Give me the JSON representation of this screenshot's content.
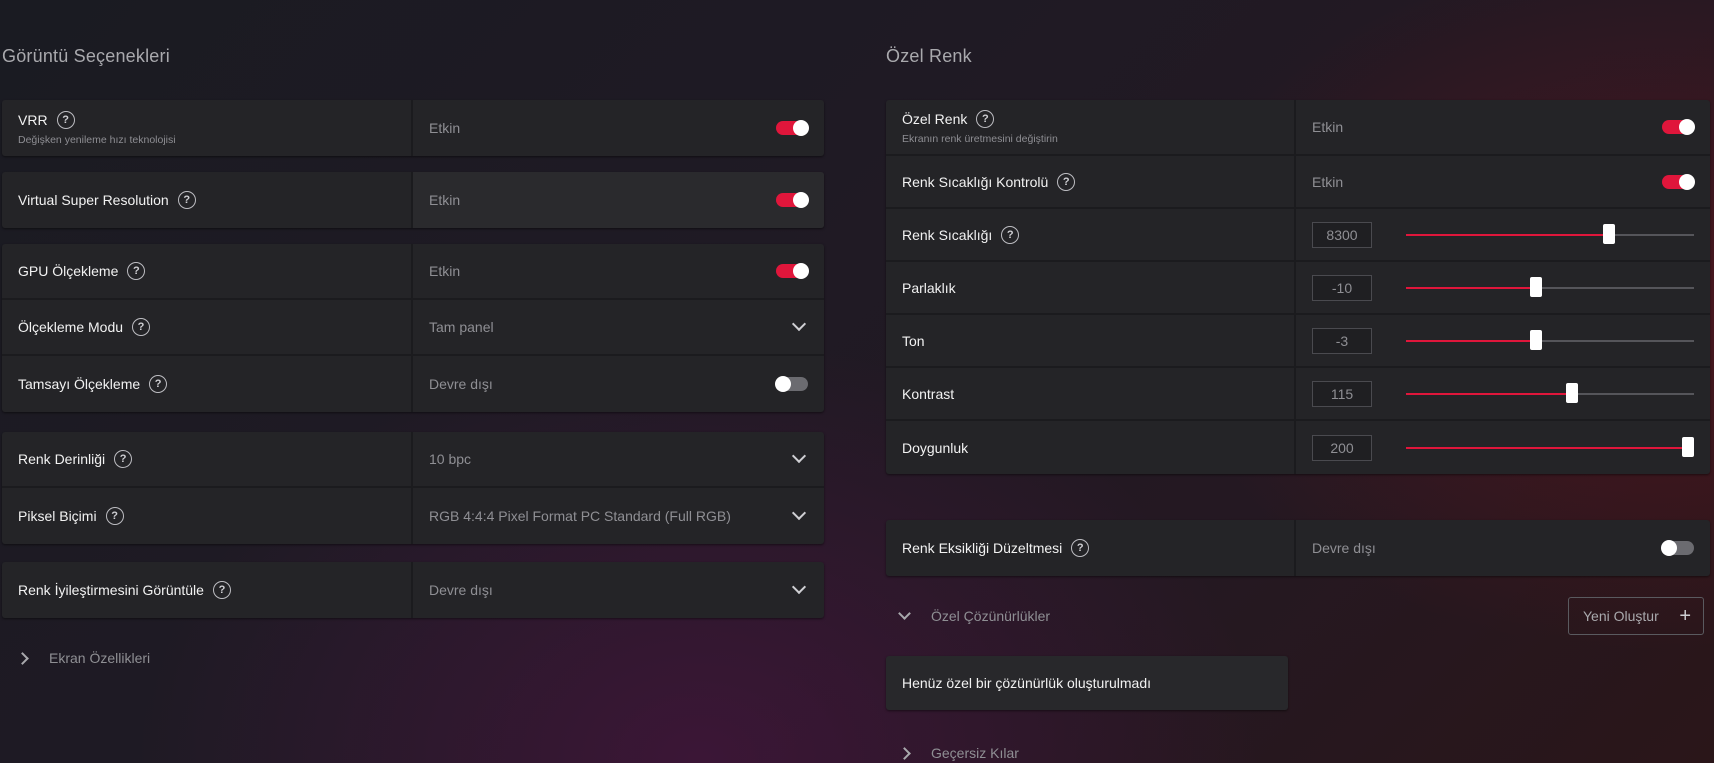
{
  "left": {
    "title": "Görüntü Seçenekleri",
    "vrr": {
      "label": "VRR",
      "sub": "Değişken yenileme hızı teknolojisi",
      "value": "Etkin",
      "enabled": true
    },
    "vsr": {
      "label": "Virtual Super Resolution",
      "value": "Etkin",
      "enabled": true
    },
    "gpu_scaling": {
      "label": "GPU Ölçekleme",
      "value": "Etkin",
      "enabled": true
    },
    "scaling_mode": {
      "label": "Ölçekleme Modu",
      "value": "Tam panel"
    },
    "integer_scaling": {
      "label": "Tamsayı Ölçekleme",
      "value": "Devre dışı",
      "enabled": false
    },
    "color_depth": {
      "label": "Renk Derinliği",
      "value": "10 bpc"
    },
    "pixel_format": {
      "label": "Piksel Biçimi",
      "value": "RGB 4:4:4 Pixel Format PC Standard (Full RGB)"
    },
    "color_enhance": {
      "label": "Renk İyileştirmesini Görüntüle",
      "value": "Devre dışı"
    },
    "display_specs": {
      "label": "Ekran Özellikleri"
    }
  },
  "right": {
    "title": "Özel Renk",
    "custom_color": {
      "label": "Özel Renk",
      "sub": "Ekranın renk üretmesini değiştirin",
      "value": "Etkin",
      "enabled": true
    },
    "temp_control": {
      "label": "Renk Sıcaklığı Kontrolü",
      "value": "Etkin",
      "enabled": true
    },
    "sliders": [
      {
        "label": "Renk Sıcaklığı",
        "value": "8300",
        "fraction": 0.705
      },
      {
        "label": "Parlaklık",
        "value": "-10",
        "fraction": 0.45
      },
      {
        "label": "Ton",
        "value": "-3",
        "fraction": 0.45
      },
      {
        "label": "Kontrast",
        "value": "115",
        "fraction": 0.575
      },
      {
        "label": "Doygunluk",
        "value": "200",
        "fraction": 1.0
      }
    ],
    "color_deficiency": {
      "label": "Renk Eksikliği Düzeltmesi",
      "value": "Devre dışı",
      "enabled": false
    },
    "custom_res": {
      "label": "Özel Çözünürlükler",
      "new_button": "Yeni Oluştur",
      "empty": "Henüz özel bir çözünürlük oluşturulmadı"
    },
    "invalid_edges": {
      "label": "Geçersiz Kılar"
    }
  },
  "colors": {
    "accent": "#e0163b",
    "card": "#242427",
    "muted": "#8f8f94"
  }
}
